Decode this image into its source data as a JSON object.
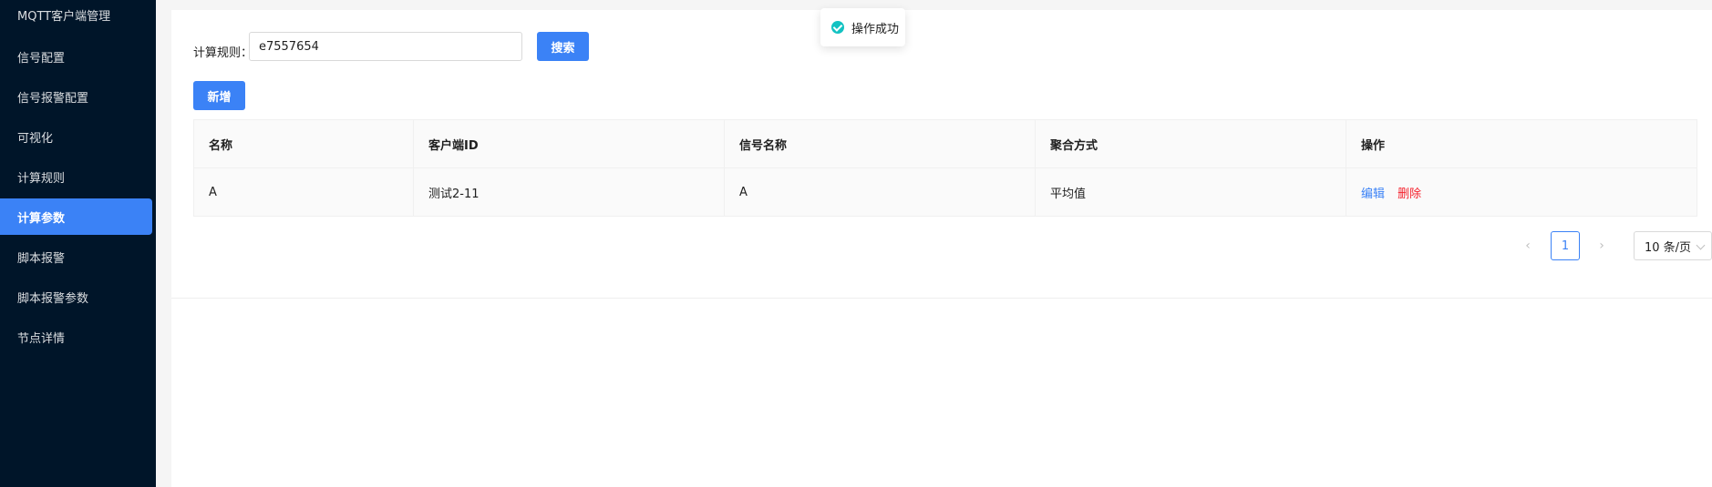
{
  "sidebar": {
    "items": [
      {
        "label": "MQTT客户端管理"
      },
      {
        "label": "信号配置"
      },
      {
        "label": "信号报警配置"
      },
      {
        "label": "可视化"
      },
      {
        "label": "计算规则"
      },
      {
        "label": "计算参数",
        "active": true
      },
      {
        "label": "脚本报警"
      },
      {
        "label": "脚本报警参数"
      },
      {
        "label": "节点详情"
      }
    ]
  },
  "search": {
    "label": "计算规则：",
    "value": "e7557654",
    "button_label": "搜索"
  },
  "toolbar": {
    "add_label": "新增"
  },
  "table": {
    "columns": [
      "名称",
      "客户端ID",
      "信号名称",
      "聚合方式",
      "操作"
    ],
    "rows": [
      {
        "name": "A",
        "client_id": "测试2-11",
        "signal_name": "A",
        "aggregation": "平均值",
        "actions": {
          "edit": "编辑",
          "delete": "删除"
        }
      }
    ]
  },
  "pagination": {
    "prev": "‹",
    "next": "›",
    "current_page": "1",
    "page_size": "10 条/页"
  },
  "toast": {
    "message": "操作成功"
  },
  "colors": {
    "sidebar_bg": "#001529",
    "accent": "#3b82f6",
    "danger": "#f5222d",
    "success": "#13c2c2"
  }
}
